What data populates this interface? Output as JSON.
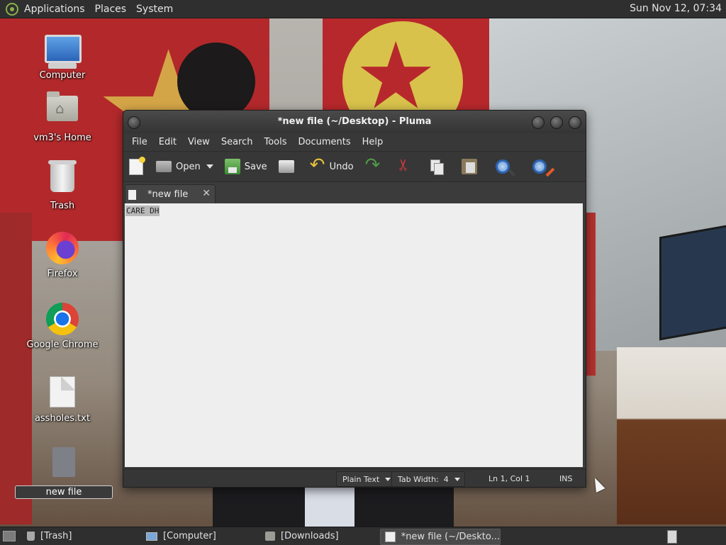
{
  "top_panel": {
    "menus": [
      "Applications",
      "Places",
      "System"
    ],
    "clock": "Sun Nov 12, 07:34"
  },
  "desktop_icons": [
    {
      "label": "Computer",
      "icon": "computer-icon"
    },
    {
      "label": "vm3's Home",
      "icon": "home-folder-icon"
    },
    {
      "label": "Trash",
      "icon": "trash-icon"
    },
    {
      "label": "Firefox",
      "icon": "firefox-icon"
    },
    {
      "label": "Google Chrome",
      "icon": "chrome-icon"
    },
    {
      "label": "assholes.txt",
      "icon": "text-file-icon"
    },
    {
      "label": "new file",
      "icon": "file-icon",
      "selected": true
    }
  ],
  "window": {
    "title": "*new file (~/Desktop) - Pluma",
    "menu": [
      "File",
      "Edit",
      "View",
      "Search",
      "Tools",
      "Documents",
      "Help"
    ],
    "toolbar": {
      "open_label": "Open",
      "save_label": "Save",
      "undo_label": "Undo"
    },
    "tab": {
      "label": "*new file",
      "close": "✕"
    },
    "editor": {
      "text": "CARE DH"
    },
    "status": {
      "language": "Plain Text",
      "tab_width": "Tab Width:  4",
      "position": "Ln 1, Col 1",
      "mode": "INS"
    }
  },
  "taskbar": {
    "items": [
      {
        "label": "[Trash]",
        "icon": "trash-icon"
      },
      {
        "label": "[Computer]",
        "icon": "computer-icon"
      },
      {
        "label": "[Downloads]",
        "icon": "folder-icon"
      },
      {
        "label": "*new file (~/Deskto...",
        "icon": "pluma-icon",
        "active": true
      }
    ]
  },
  "colors": {
    "panel": "#2f2f2f",
    "window_chrome": "#3b3b3b",
    "editor_bg": "#eeeeee",
    "selection": "#b9b9b9"
  }
}
